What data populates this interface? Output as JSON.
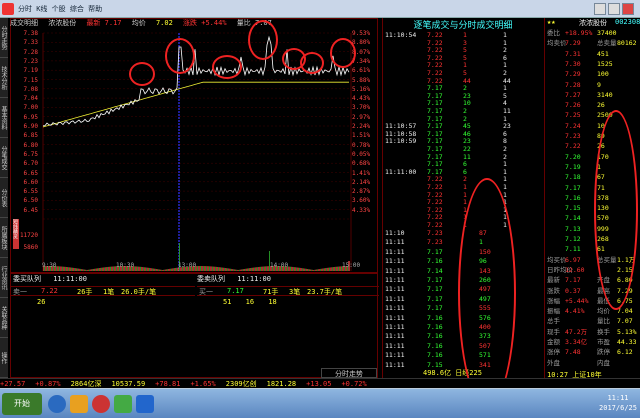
{
  "window": {
    "title": "",
    "menu_items": [
      "分时",
      "K线",
      "个股",
      "综合",
      "帮助"
    ]
  },
  "left_tabs": [
    "分时走势",
    "技术分析",
    "基本资料",
    "分笔成交",
    "分价表",
    "所属板块",
    "行业资讯",
    "关联品种",
    "操作"
  ],
  "chart": {
    "header": [
      "成交明细",
      "浓浓股份",
      "最新 7.17",
      "均价",
      "7.02",
      "涨跌 +5.44%",
      "量比 7.07"
    ],
    "price_labels_left": [
      "7.38",
      "7.33",
      "7.28",
      "7.23",
      "7.19",
      "7.15",
      "7.08",
      "7.04",
      "7.00",
      "6.95",
      "6.90",
      "6.85",
      "6.80",
      "6.75",
      "6.70",
      "6.65",
      "6.60",
      "6.55",
      "6.50",
      "6.45"
    ],
    "price_labels_right": [
      "9.53%",
      "8.80%",
      "8.07%",
      "7.34%",
      "6.61%",
      "5.88%",
      "5.16%",
      "4.43%",
      "3.70%",
      "2.97%",
      "2.24%",
      "1.51%",
      "0.78%",
      "0.05%",
      "0.68%",
      "1.41%",
      "2.14%",
      "2.87%",
      "3.60%",
      "4.33%"
    ],
    "volume_labels": [
      "11720",
      "5860"
    ],
    "time_labels": [
      "9:30",
      "10:30",
      "13:00",
      "14:00",
      "15:00"
    ],
    "side_tag": "短线精灵"
  },
  "queue": {
    "buy_title": "委买队列",
    "buy_time": "11:11:00",
    "sell_title": "委卖队列",
    "sell_time": "11:11:00",
    "buy_row": [
      "卖一",
      "7.22",
      "26手",
      "1笔",
      "26.0手/笔"
    ],
    "buy_detail": "26",
    "sell_row": [
      "买一",
      "7.17",
      "71手",
      "3笔",
      "23.7手/笔"
    ],
    "sell_detail": [
      "51",
      "16",
      "18"
    ],
    "footer": "分时走势"
  },
  "trades": {
    "title": "逐笔成交与分时成交明细",
    "rows": [
      [
        "11:10:54",
        "7.22",
        "1",
        "1"
      ],
      [
        "",
        "7.22",
        "3",
        "1"
      ],
      [
        "",
        "7.22",
        "5",
        "2"
      ],
      [
        "",
        "7.22",
        "5",
        "6"
      ],
      [
        "",
        "7.22",
        "1",
        "1"
      ],
      [
        "",
        "7.22",
        "5",
        "2"
      ],
      [
        "",
        "7.22",
        "44",
        "44"
      ],
      [
        "",
        "7.17",
        "2",
        "1"
      ],
      [
        "",
        "7.17",
        "23",
        "5"
      ],
      [
        "",
        "7.17",
        "10",
        "4"
      ],
      [
        "",
        "7.17",
        "2",
        "11"
      ],
      [
        "",
        "7.17",
        "2",
        "1"
      ],
      [
        "11:10:57",
        "7.17",
        "45",
        "23"
      ],
      [
        "11:10:58",
        "7.17",
        "46",
        "6"
      ],
      [
        "11:10:59",
        "7.17",
        "23",
        "8"
      ],
      [
        "",
        "7.17",
        "22",
        "2"
      ],
      [
        "",
        "7.17",
        "11",
        "2"
      ],
      [
        "",
        "7.17",
        "6",
        "1"
      ],
      [
        "11:11:00",
        "7.17",
        "6",
        "1"
      ],
      [
        "",
        "7.22",
        "2",
        "1"
      ],
      [
        "",
        "7.22",
        "1",
        "1"
      ],
      [
        "",
        "7.22",
        "1",
        "1"
      ],
      [
        "",
        "7.22",
        "1",
        "1"
      ],
      [
        "",
        "7.22",
        "1",
        "1"
      ],
      [
        "",
        "7.22",
        "1",
        "1"
      ],
      [
        "",
        "7.22",
        "1",
        "1"
      ]
    ],
    "rows2": [
      [
        "11:10",
        "7.23",
        "87"
      ],
      [
        "11:11",
        "7.23",
        "1"
      ],
      [
        "11:11",
        "7.17",
        "150"
      ],
      [
        "11:11",
        "7.16",
        "96"
      ],
      [
        "11:11",
        "7.14",
        "143"
      ],
      [
        "11:11",
        "7.17",
        "260"
      ],
      [
        "11:11",
        "7.17",
        "497"
      ],
      [
        "11:11",
        "7.17",
        "497"
      ],
      [
        "11:11",
        "7.17",
        "555"
      ],
      [
        "11:11",
        "7.16",
        "576"
      ],
      [
        "11:11",
        "7.16",
        "400"
      ],
      [
        "11:11",
        "7.16",
        "373"
      ],
      [
        "11:11",
        "7.16",
        "507"
      ],
      [
        "11:11",
        "7.16",
        "571"
      ],
      [
        "11:11",
        "7.15",
        "341"
      ]
    ],
    "footer": "498.6亿   日经225"
  },
  "right": {
    "stock": "浓浓股份",
    "code": "002308",
    "rows": [
      [
        "委比",
        "+18.95%",
        "37400"
      ],
      [
        "均卖价",
        "7.29",
        "总卖量",
        "80162"
      ],
      [
        "",
        "7.31",
        "451"
      ],
      [
        "",
        "7.30",
        "1525"
      ],
      [
        "",
        "7.29",
        "100"
      ],
      [
        "",
        "7.28",
        "9"
      ],
      [
        "",
        "7.27",
        "3140"
      ],
      [
        "",
        "7.26",
        "26"
      ],
      [
        "",
        "7.25",
        "2500"
      ],
      [
        "",
        "7.24",
        "10"
      ],
      [
        "",
        "7.23",
        "89"
      ],
      [
        "",
        "7.22",
        "26"
      ],
      [
        "",
        "7.20",
        "170"
      ],
      [
        "",
        "7.19",
        "1"
      ],
      [
        "",
        "7.18",
        "67"
      ],
      [
        "",
        "7.17",
        "71"
      ],
      [
        "",
        "7.16",
        "378"
      ],
      [
        "",
        "7.15",
        "130"
      ],
      [
        "",
        "7.14",
        "570"
      ],
      [
        "",
        "7.13",
        "999"
      ],
      [
        "",
        "7.12",
        "268"
      ],
      [
        "",
        "7.11",
        "61"
      ],
      [
        "均买价",
        "6.97",
        "总买量",
        "1.1万"
      ],
      [
        "日昨均价",
        "12.60",
        "",
        "2.15"
      ],
      [
        "最新",
        "7.17",
        "开盘",
        "6.80"
      ],
      [
        "涨跌",
        "0.37",
        "最高",
        "7.29"
      ],
      [
        "涨幅",
        "+5.44%",
        "最低",
        "6.75"
      ],
      [
        "振幅",
        "4.41%",
        "均价",
        "7.04"
      ],
      [
        "总手",
        "",
        "量比",
        "7.07"
      ],
      [
        "现手",
        "47.2万",
        "换手",
        "5.13%"
      ],
      [
        "金额",
        "3.34亿",
        "市盈",
        "44.33"
      ],
      [
        "涨停",
        "7.48",
        "跌停",
        "6.12"
      ],
      [
        "外盘",
        "",
        "内盘",
        ""
      ]
    ],
    "footer": "10:27 上证10年"
  },
  "ticker": [
    "+27.57",
    "+0.87%",
    "2864亿深",
    "10537.59",
    "+78.81",
    "+1.65%",
    "2309亿创",
    "1821.28",
    "+13.05",
    "+0.72%"
  ],
  "taskbar": {
    "start": "开始",
    "clock": "11:11",
    "date": "2017/6/25"
  }
}
